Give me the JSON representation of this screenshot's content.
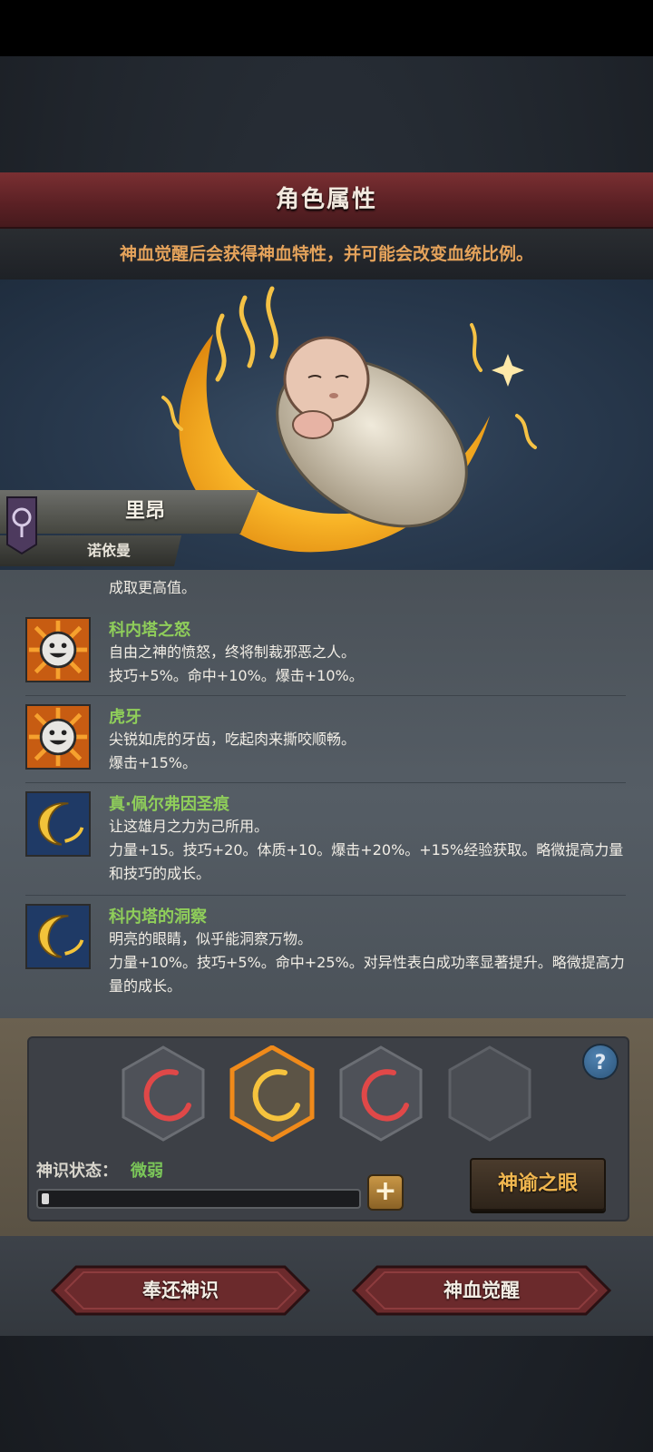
{
  "header": {
    "title": "角色属性",
    "subtitle": "神血觉醒后会获得神血特性，并可能会改变血统比例。"
  },
  "character": {
    "name": "里昂",
    "region": "诺依曼"
  },
  "traits": {
    "partial_text": "成取更高值。",
    "items": [
      {
        "name": "科内塔之怒",
        "description": "自由之神的愤怒，终将制裁邪恶之人。",
        "effects": "技巧+5%。命中+10%。爆击+10%。",
        "icon": "sun-face-icon"
      },
      {
        "name": "虎牙",
        "description": "尖锐如虎的牙齿，吃起肉来撕咬顺畅。",
        "effects": "爆击+15%。",
        "icon": "sun-face-icon"
      },
      {
        "name": "真·佩尔弗因圣痕",
        "description": "让这雄月之力为己所用。",
        "effects": "力量+15。技巧+20。体质+10。爆击+20%。+15%经验获取。略微提高力量和技巧的成长。",
        "icon": "crescent-moon-icon"
      },
      {
        "name": "科内塔的洞察",
        "description": "明亮的眼睛，似乎能洞察万物。",
        "effects": "力量+10%。技巧+5%。命中+25%。对异性表白成功率显著提升。略微提高力量的成长。",
        "icon": "crescent-moon-icon"
      }
    ]
  },
  "blood_panel": {
    "slots": [
      {
        "state": "red",
        "icon": "red-crescent-icon"
      },
      {
        "state": "selected-gold",
        "icon": "gold-crescent-icon"
      },
      {
        "state": "red",
        "icon": "red-crescent-icon"
      },
      {
        "state": "empty",
        "icon": ""
      }
    ],
    "help_label": "?",
    "status_label": "神识状态：",
    "status_value": "微弱",
    "progress_fraction": 0.02,
    "plus_label": "+",
    "oracle_button": "神谕之眼"
  },
  "footer": {
    "return_button": "奉还神识",
    "awaken_button": "神血觉醒"
  },
  "colors": {
    "title_bar": "#5a2024",
    "subtitle_text": "#e5a35b",
    "trait_name": "#8fce5a",
    "status_value": "#7bc659",
    "oracle_text": "#f0b64f"
  }
}
